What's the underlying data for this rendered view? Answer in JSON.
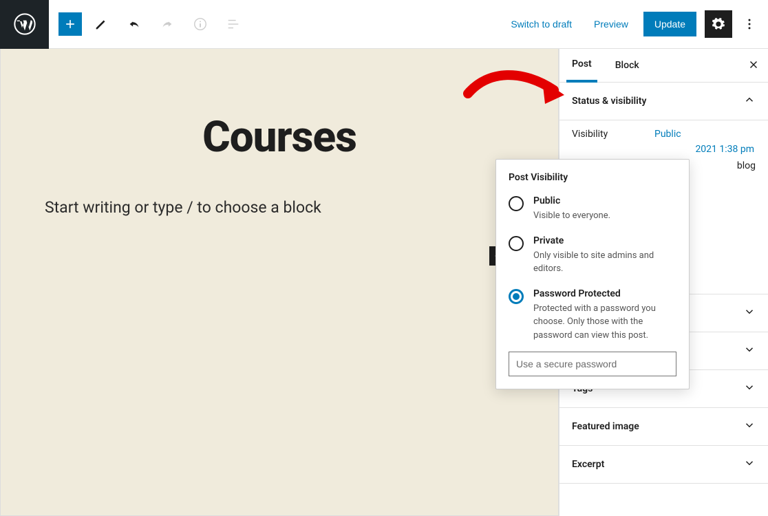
{
  "topbar": {
    "switch_draft": "Switch to draft",
    "preview": "Preview",
    "update": "Update"
  },
  "canvas": {
    "title": "Courses",
    "placeholder": "Start writing or type / to choose a block"
  },
  "sidebar": {
    "tabs": {
      "post": "Post",
      "block": "Block"
    },
    "status_visibility": {
      "heading": "Status & visibility",
      "visibility_label": "Visibility",
      "visibility_value": "Public",
      "publish_datetime": "2021 1:38 pm",
      "blog_text": "blog"
    },
    "sections": {
      "tags": "Tags",
      "featured_image": "Featured image",
      "excerpt": "Excerpt"
    }
  },
  "popover": {
    "title": "Post Visibility",
    "options": [
      {
        "title": "Public",
        "desc": "Visible to everyone."
      },
      {
        "title": "Private",
        "desc": "Only visible to site admins and editors."
      },
      {
        "title": "Password Protected",
        "desc": "Protected with a password you choose. Only those with the password can view this post."
      }
    ],
    "password_placeholder": "Use a secure password"
  }
}
